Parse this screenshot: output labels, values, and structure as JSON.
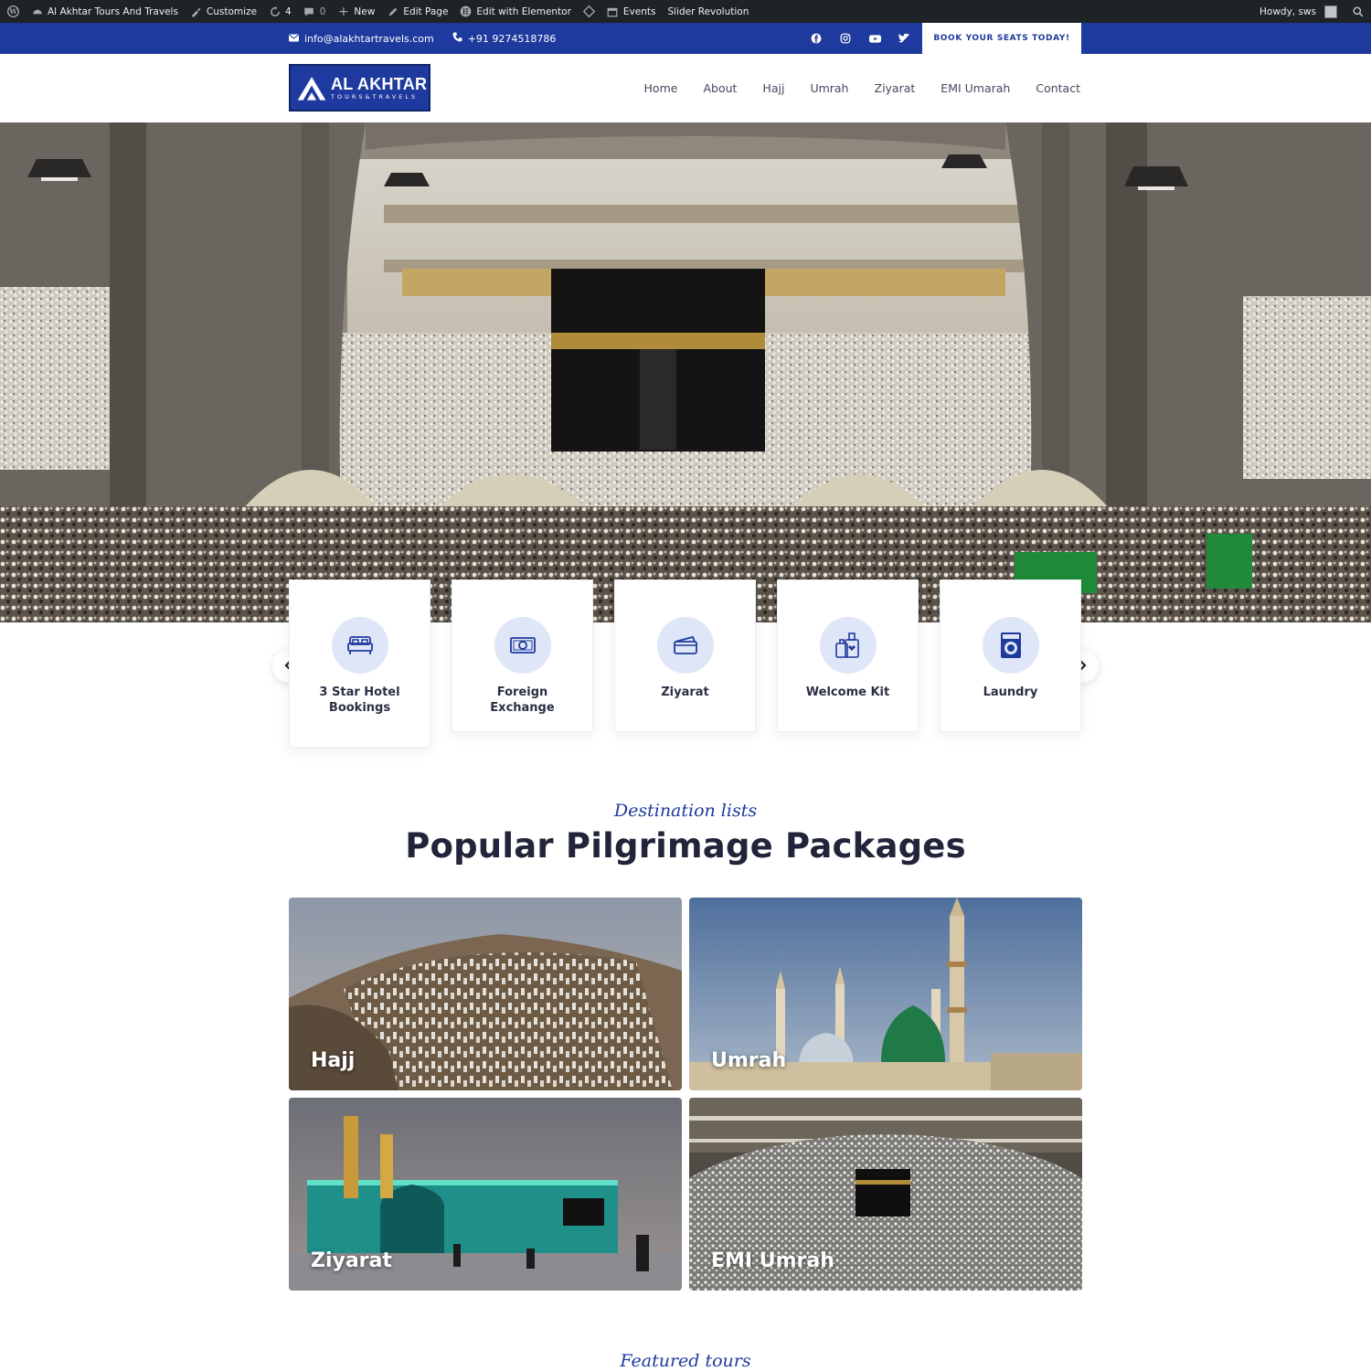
{
  "admin_bar": {
    "site_name": "Al Akhtar Tours And Travels",
    "customize": "Customize",
    "updates_count": "4",
    "comments_count": "0",
    "new": "New",
    "edit_page": "Edit Page",
    "edit_elementor": "Edit with Elementor",
    "events": "Events",
    "slider_revolution": "Slider Revolution",
    "howdy": "Howdy, sws"
  },
  "topbar": {
    "email": "info@alakhtartravels.com",
    "phone": "+91 9274518786",
    "social_icons": [
      "facebook-icon",
      "instagram-icon",
      "youtube-icon",
      "twitter-icon"
    ],
    "cta": "BOOK YOUR SEATS TODAY!"
  },
  "header": {
    "logo_title": "AL AKHTAR",
    "logo_subtitle": "TOURS&TRAVELS",
    "nav": [
      "Home",
      "About",
      "Hajj",
      "Umrah",
      "Ziyarat",
      "EMI Umarah",
      "Contact"
    ]
  },
  "services": [
    {
      "label": "3 Star Hotel Bookings",
      "icon": "bed-icon"
    },
    {
      "label": "Foreign Exchange",
      "icon": "money-icon"
    },
    {
      "label": "Ziyarat",
      "icon": "wallet-icon"
    },
    {
      "label": "Welcome Kit",
      "icon": "luggage-icon"
    },
    {
      "label": "Laundry",
      "icon": "washing-machine-icon"
    }
  ],
  "destinations": {
    "script_label": "Destination lists",
    "title": "Popular Pilgrimage Packages",
    "packages": [
      "Hajj",
      "Umrah",
      "Ziyarat",
      "EMI Umrah"
    ]
  },
  "next_section": {
    "script_label": "Featured tours"
  },
  "colors": {
    "brand_blue": "#1e3a9e",
    "admin_bar": "#1d2327",
    "icon_circle": "#dfe6f7"
  }
}
